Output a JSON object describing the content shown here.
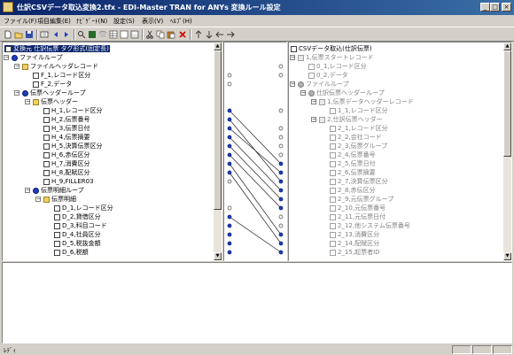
{
  "window": {
    "title": "仕訳CSVデータ取込変換2.tfx - EDI-Master TRAN for ANYs 変換ルール設定",
    "minimize_glyph": "_",
    "maximize_glyph": "□",
    "close_glyph": "×"
  },
  "menu": [
    "ファイル(F)",
    "項目編集(E)",
    "ﾅﾋﾞｹﾞｰﾄ(N)",
    "設定(S)",
    "表示(V)",
    "ﾍﾙﾌﾟ(H)"
  ],
  "toolbar_icons": [
    "new-icon",
    "open-icon",
    "save-icon",
    "properties-icon",
    "back-icon",
    "forward-icon",
    "find-icon",
    "disk-icon",
    "db-icon",
    "table-icon",
    "text-icon",
    "calc-icon",
    "cut-icon",
    "copy-icon",
    "paste-icon",
    "delete-icon",
    "up-icon",
    "down-icon",
    "left-icon",
    "right-icon"
  ],
  "left_tree": [
    {
      "label": "変換元 仕訳伝票 タグ形式(固定長)",
      "icon": "doc-icon",
      "selected": true
    },
    {
      "label": "ファイルループ",
      "icon": "loop-icon"
    },
    {
      "label": "ファイルヘッダレコード",
      "icon": "folder-icon"
    },
    {
      "label": "F_1,レコード区分",
      "icon": "doc-icon"
    },
    {
      "label": "F_2,データ",
      "icon": "doc-icon"
    },
    {
      "label": "伝票ヘッダーループ",
      "icon": "loop-icon"
    },
    {
      "label": "伝票ヘッダー",
      "icon": "folder-icon"
    },
    {
      "label": "H_1,レコード区分",
      "icon": "doc-icon"
    },
    {
      "label": "H_2,伝票番号",
      "icon": "doc-icon"
    },
    {
      "label": "H_3,伝票日付",
      "icon": "doc-icon"
    },
    {
      "label": "H_4,伝票摘要",
      "icon": "doc-icon"
    },
    {
      "label": "H_5,決算伝票区分",
      "icon": "doc-icon"
    },
    {
      "label": "H_6,赤伝区分",
      "icon": "doc-icon"
    },
    {
      "label": "H_7,消費区分",
      "icon": "doc-icon"
    },
    {
      "label": "H_8,配賦区分",
      "icon": "doc-icon"
    },
    {
      "label": "H_9,FILLER03",
      "icon": "doc-icon"
    },
    {
      "label": "伝票明細ループ",
      "icon": "loop-icon"
    },
    {
      "label": "伝票明細",
      "icon": "folder-icon"
    },
    {
      "label": "D_1,レコード区分",
      "icon": "doc-icon"
    },
    {
      "label": "D_2,貸借区分",
      "icon": "doc-icon"
    },
    {
      "label": "D_3,科目コード",
      "icon": "doc-icon"
    },
    {
      "label": "D_4,社員区分",
      "icon": "doc-icon"
    },
    {
      "label": "D_5,税抜金額",
      "icon": "doc-icon"
    },
    {
      "label": "D_6,税額",
      "icon": "doc-icon"
    }
  ],
  "right_tree": [
    {
      "label": "CSVデータ取込(仕訳伝票)",
      "icon": "doc-icon"
    },
    {
      "label": "1,伝票スタートレコード",
      "icon": "folder-icon"
    },
    {
      "label": "0_1,レコード区分",
      "icon": "doc-icon"
    },
    {
      "label": "0_2,データ",
      "icon": "doc-icon"
    },
    {
      "label": "ファイルループ",
      "icon": "loop-icon"
    },
    {
      "label": "仕訳伝票ヘッダーループ",
      "icon": "loop-icon"
    },
    {
      "label": "1,伝票データヘッダーレコード",
      "icon": "folder-icon"
    },
    {
      "label": "1_1,レコード区分",
      "icon": "doc-icon"
    },
    {
      "label": "2,仕訳伝票ヘッダー",
      "icon": "folder-icon"
    },
    {
      "label": "2_1,レコード区分",
      "icon": "doc-icon"
    },
    {
      "label": "2_2,会社コード",
      "icon": "doc-icon"
    },
    {
      "label": "2_3,伝票グループ",
      "icon": "doc-icon"
    },
    {
      "label": "2_4,伝票番号",
      "icon": "doc-icon"
    },
    {
      "label": "2_5,伝票日付",
      "icon": "doc-icon"
    },
    {
      "label": "2_6,伝票摘要",
      "icon": "doc-icon"
    },
    {
      "label": "2_7,決算伝票区分",
      "icon": "doc-icon"
    },
    {
      "label": "2_8,赤伝区分",
      "icon": "doc-icon"
    },
    {
      "label": "2_9,元伝票グループ",
      "icon": "doc-icon"
    },
    {
      "label": "2_10,元伝票番号",
      "icon": "doc-icon"
    },
    {
      "label": "2_11,元伝票日付",
      "icon": "doc-icon"
    },
    {
      "label": "2_12,他システム伝票番号",
      "icon": "doc-icon"
    },
    {
      "label": "2_13,消費区分",
      "icon": "doc-icon"
    },
    {
      "label": "2_14,配賦区分",
      "icon": "doc-icon"
    },
    {
      "label": "2_15,起票者ID",
      "icon": "doc-icon"
    }
  ],
  "mapping_mark": "●",
  "empty_mark": "○",
  "status": {
    "text": "ﾚﾃﾞｨ"
  }
}
